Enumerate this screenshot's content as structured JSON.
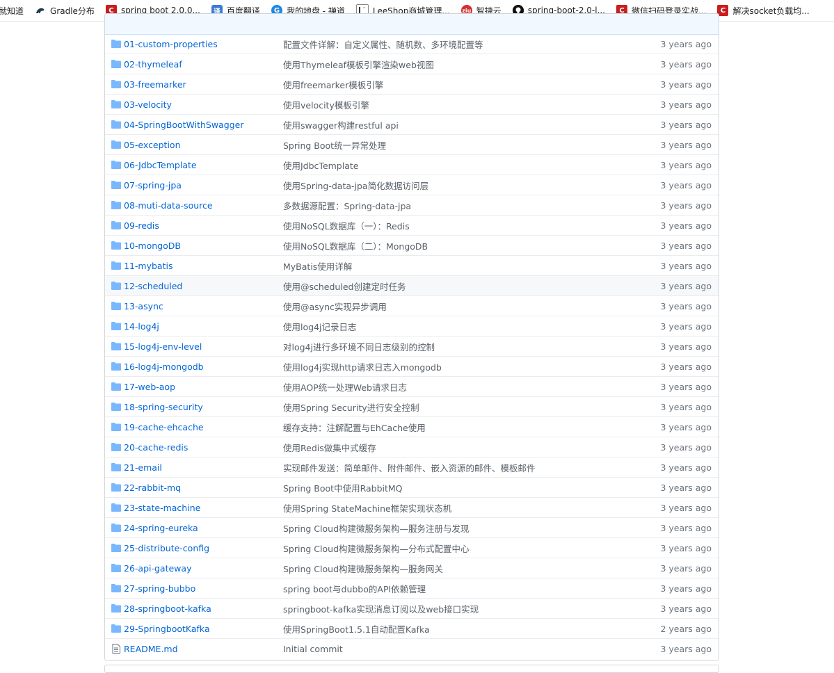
{
  "bookmarks": [
    {
      "label": "就知道",
      "icon": "none"
    },
    {
      "label": "Gradle分布",
      "icon": "gradle-icon"
    },
    {
      "label": "spring boot 2.0.0...",
      "icon": "csdn-icon"
    },
    {
      "label": "百度翻译",
      "icon": "translate-icon"
    },
    {
      "label": "我的地盘 - 禅道",
      "icon": "zentao-icon"
    },
    {
      "label": "LeeShop商城管理...",
      "icon": "leeshop-icon"
    },
    {
      "label": "智捷云",
      "icon": "zhijieyun-icon"
    },
    {
      "label": "spring-boot-2.0-l...",
      "icon": "github-icon"
    },
    {
      "label": "微信扫码登录实战...",
      "icon": "csdn-icon"
    },
    {
      "label": "解决socket负载均...",
      "icon": "csdn-icon"
    }
  ],
  "files": [
    {
      "name": "01-custom-properties",
      "type": "folder",
      "message": "配置文件详解：自定义属性、随机数、多环境配置等",
      "age": "3 years ago"
    },
    {
      "name": "02-thymeleaf",
      "type": "folder",
      "message": "使用Thymeleaf模板引擎渲染web视图",
      "age": "3 years ago"
    },
    {
      "name": "03-freemarker",
      "type": "folder",
      "message": "使用freemarker模板引擎",
      "age": "3 years ago"
    },
    {
      "name": "03-velocity",
      "type": "folder",
      "message": "使用velocity模板引擎",
      "age": "3 years ago"
    },
    {
      "name": "04-SpringBootWithSwagger",
      "type": "folder",
      "message": "使用swagger构建restful api",
      "age": "3 years ago"
    },
    {
      "name": "05-exception",
      "type": "folder",
      "message": "Spring Boot统一异常处理",
      "age": "3 years ago"
    },
    {
      "name": "06-JdbcTemplate",
      "type": "folder",
      "message": "使用JdbcTemplate",
      "age": "3 years ago"
    },
    {
      "name": "07-spring-jpa",
      "type": "folder",
      "message": "使用Spring-data-jpa简化数据访问层",
      "age": "3 years ago"
    },
    {
      "name": "08-muti-data-source",
      "type": "folder",
      "message": "多数据源配置：Spring-data-jpa",
      "age": "3 years ago"
    },
    {
      "name": "09-redis",
      "type": "folder",
      "message": "使用NoSQL数据库（一）：Redis",
      "age": "3 years ago"
    },
    {
      "name": "10-mongoDB",
      "type": "folder",
      "message": "使用NoSQL数据库（二）：MongoDB",
      "age": "3 years ago"
    },
    {
      "name": "11-mybatis",
      "type": "folder",
      "message": "MyBatis使用详解",
      "age": "3 years ago"
    },
    {
      "name": "12-scheduled",
      "type": "folder",
      "message": "使用@scheduled创建定时任务",
      "age": "3 years ago"
    },
    {
      "name": "13-async",
      "type": "folder",
      "message": "使用@async实现异步调用",
      "age": "3 years ago"
    },
    {
      "name": "14-log4j",
      "type": "folder",
      "message": "使用log4j记录日志",
      "age": "3 years ago"
    },
    {
      "name": "15-log4j-env-level",
      "type": "folder",
      "message": "对log4j进行多环境不同日志级别的控制",
      "age": "3 years ago"
    },
    {
      "name": "16-log4j-mongodb",
      "type": "folder",
      "message": "使用log4j实现http请求日志入mongodb",
      "age": "3 years ago"
    },
    {
      "name": "17-web-aop",
      "type": "folder",
      "message": "使用AOP统一处理Web请求日志",
      "age": "3 years ago"
    },
    {
      "name": "18-spring-security",
      "type": "folder",
      "message": "使用Spring Security进行安全控制",
      "age": "3 years ago"
    },
    {
      "name": "19-cache-ehcache",
      "type": "folder",
      "message": "缓存支持：注解配置与EhCache使用",
      "age": "3 years ago"
    },
    {
      "name": "20-cache-redis",
      "type": "folder",
      "message": "使用Redis做集中式缓存",
      "age": "3 years ago"
    },
    {
      "name": "21-email",
      "type": "folder",
      "message": "实现邮件发送：简单邮件、附件邮件、嵌入资源的邮件、模板邮件",
      "age": "3 years ago"
    },
    {
      "name": "22-rabbit-mq",
      "type": "folder",
      "message": "Spring Boot中使用RabbitMQ",
      "age": "3 years ago"
    },
    {
      "name": "23-state-machine",
      "type": "folder",
      "message": "使用Spring StateMachine框架实现状态机",
      "age": "3 years ago"
    },
    {
      "name": "24-spring-eureka",
      "type": "folder",
      "message": "Spring Cloud构建微服务架构—服务注册与发现",
      "age": "3 years ago"
    },
    {
      "name": "25-distribute-config",
      "type": "folder",
      "message": "Spring Cloud构建微服务架构—分布式配置中心",
      "age": "3 years ago"
    },
    {
      "name": "26-api-gateway",
      "type": "folder",
      "message": "Spring Cloud构建微服务架构—服务网关",
      "age": "3 years ago"
    },
    {
      "name": "27-spring-bubbo",
      "type": "folder",
      "message": "spring boot与dubbo的API依赖管理",
      "age": "3 years ago"
    },
    {
      "name": "28-springboot-kafka",
      "type": "folder",
      "message": "springboot-kafka实现消息订阅以及web接口实现",
      "age": "3 years ago"
    },
    {
      "name": "29-SpringbootKafka",
      "type": "folder",
      "message": "使用SpringBoot1.5.1自动配置Kafka",
      "age": "2 years ago"
    },
    {
      "name": "README.md",
      "type": "file",
      "message": "Initial commit",
      "age": "3 years ago"
    }
  ],
  "highlighted_row": "12-scheduled",
  "colors": {
    "link": "#0366d6",
    "folder": "#79b8ff",
    "file": "#6a737d",
    "row_highlight": "#f6f8fa"
  }
}
